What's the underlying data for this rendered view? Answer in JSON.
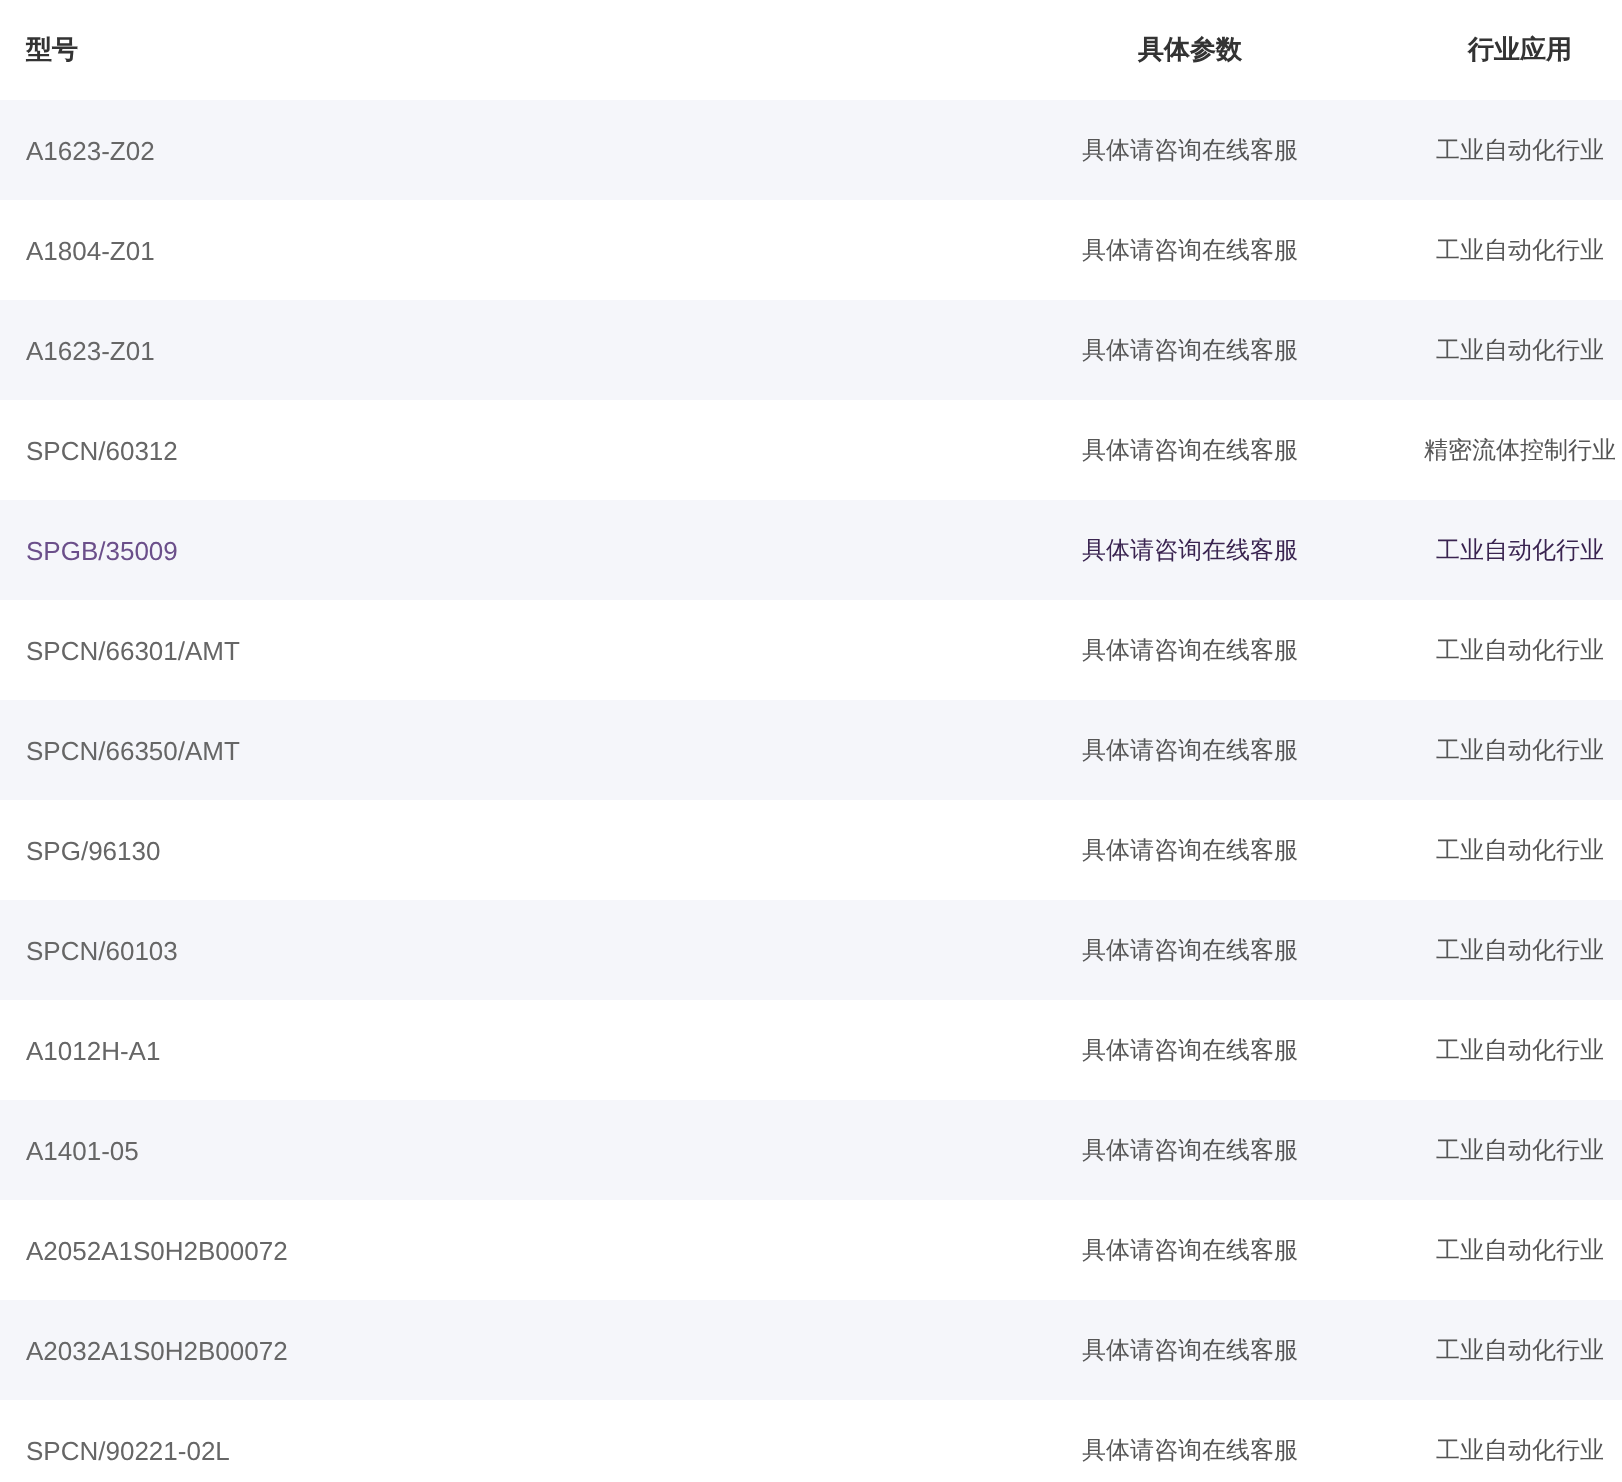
{
  "table": {
    "columns": [
      "型号",
      "具体参数",
      "行业应用"
    ],
    "rows": [
      {
        "model": "A1623-Z02",
        "params": "具体请咨询在线客服",
        "industry": "工业自动化行业",
        "selected": false
      },
      {
        "model": "A1804-Z01",
        "params": "具体请咨询在线客服",
        "industry": "工业自动化行业",
        "selected": false
      },
      {
        "model": "A1623-Z01",
        "params": "具体请咨询在线客服",
        "industry": "工业自动化行业",
        "selected": false
      },
      {
        "model": "SPCN/60312",
        "params": "具体请咨询在线客服",
        "industry": "精密流体控制行业",
        "selected": false
      },
      {
        "model": "SPGB/35009",
        "params": "具体请咨询在线客服",
        "industry": "工业自动化行业",
        "selected": true
      },
      {
        "model": "SPCN/66301/AMT",
        "params": "具体请咨询在线客服",
        "industry": "工业自动化行业",
        "selected": false
      },
      {
        "model": "SPCN/66350/AMT",
        "params": "具体请咨询在线客服",
        "industry": "工业自动化行业",
        "selected": false
      },
      {
        "model": "SPG/96130",
        "params": "具体请咨询在线客服",
        "industry": "工业自动化行业",
        "selected": false
      },
      {
        "model": "SPCN/60103",
        "params": "具体请咨询在线客服",
        "industry": "工业自动化行业",
        "selected": false
      },
      {
        "model": "A1012H-A1",
        "params": "具体请咨询在线客服",
        "industry": "工业自动化行业",
        "selected": false
      },
      {
        "model": "A1401-05",
        "params": "具体请咨询在线客服",
        "industry": "工业自动化行业",
        "selected": false
      },
      {
        "model": "A2052A1S0H2B00072",
        "params": "具体请咨询在线客服",
        "industry": "工业自动化行业",
        "selected": false
      },
      {
        "model": "A2032A1S0H2B00072",
        "params": "具体请咨询在线客服",
        "industry": "工业自动化行业",
        "selected": false
      },
      {
        "model": "SPCN/90221-02L",
        "params": "具体请咨询在线客服",
        "industry": "工业自动化行业",
        "selected": false
      }
    ]
  }
}
